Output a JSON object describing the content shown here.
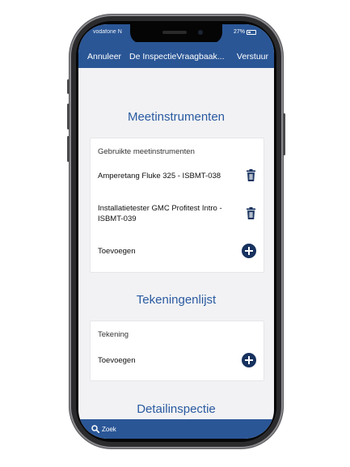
{
  "status_bar": {
    "carrier": "vodafone N",
    "battery": "27%"
  },
  "nav": {
    "cancel": "Annuleer",
    "title": "De InspectieVraagbaak...",
    "send": "Verstuur"
  },
  "sections": [
    {
      "title": "Meetinstrumenten",
      "header": "Gebruikte meetinstrumenten",
      "items": [
        "Amperetang Fluke 325 - ISBMT-038",
        "Installatietester GMC Profitest Intro - ISBMT-039"
      ],
      "add_label": "Toevoegen"
    },
    {
      "title": "Tekeningenlijst",
      "header": "Tekening",
      "add_label": "Toevoegen"
    },
    {
      "title": "Detailinspectie"
    }
  ],
  "bottom_bar": {
    "search_label": "Zoek"
  },
  "icons": {
    "delete": "trash-icon",
    "add": "plus-circle-icon",
    "search": "search-icon"
  },
  "colors": {
    "accent": "#2a5696",
    "title": "#2a5aa0",
    "add_button": "#17325f"
  }
}
